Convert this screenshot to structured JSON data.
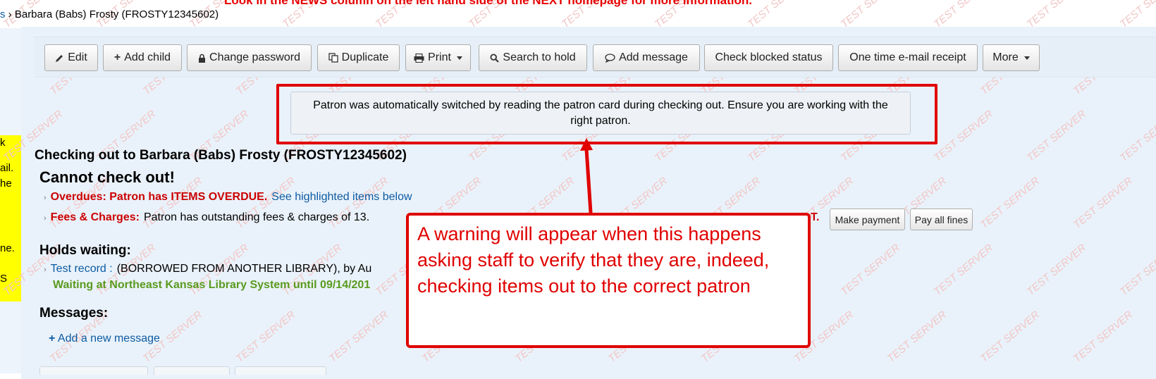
{
  "top_notice": "Look in the NEWS column on the left hand side of the NEXT homepage for more information.",
  "breadcrumb": {
    "link_fragment": "s",
    "separator": "›",
    "current": "Barbara (Babs) Frosty (FROSTY12345602)"
  },
  "left_panel_fragments": [
    "k",
    "ail.",
    "he",
    "ne.",
    "S"
  ],
  "toolbar": {
    "edit": "Edit",
    "add_child": "Add child",
    "change_password": "Change password",
    "duplicate": "Duplicate",
    "print": "Print",
    "search_to_hold": "Search to hold",
    "add_message": "Add message",
    "check_blocked_status": "Check blocked status",
    "one_time_email_receipt": "One time e-mail receipt",
    "more": "More"
  },
  "alert": {
    "message": "Patron was automatically switched by reading the patron card during checking out. Ensure you are working with the right patron."
  },
  "checkout": {
    "heading": "Checking out to Barbara (Babs) Frosty (FROSTY12345602)",
    "cannot_checkout": "Cannot check out!",
    "overdues_label": "Overdues: Patron has ITEMS OVERDUE.",
    "overdues_link": "See highlighted items below",
    "fees_label": "Fees & Charges:",
    "fees_text": "Patron has outstanding fees & charges of 13.",
    "fees_tail": "T.",
    "make_payment": "Make payment",
    "pay_all_fines": "Pay all fines"
  },
  "holds": {
    "heading": "Holds waiting:",
    "record_link": "Test record :",
    "record_text": "(BORROWED FROM ANOTHER LIBRARY), by Au",
    "waiting_text": "Waiting at Northeast Kansas Library System until 09/14/201"
  },
  "messages": {
    "heading": "Messages:",
    "add_new": "Add a new message"
  },
  "callout": {
    "text": "A warning will appear when this happens asking staff to verify that they are, indeed, checking items out to the correct patron"
  },
  "watermark_text": "TEST SERVER",
  "colors": {
    "annotation_red": "#e00000",
    "link_blue": "#0e5ba3",
    "panel_bg": "#e9f2fa",
    "waiting_green": "#5a9a1e",
    "sidebar_yellow": "#ffff00"
  }
}
